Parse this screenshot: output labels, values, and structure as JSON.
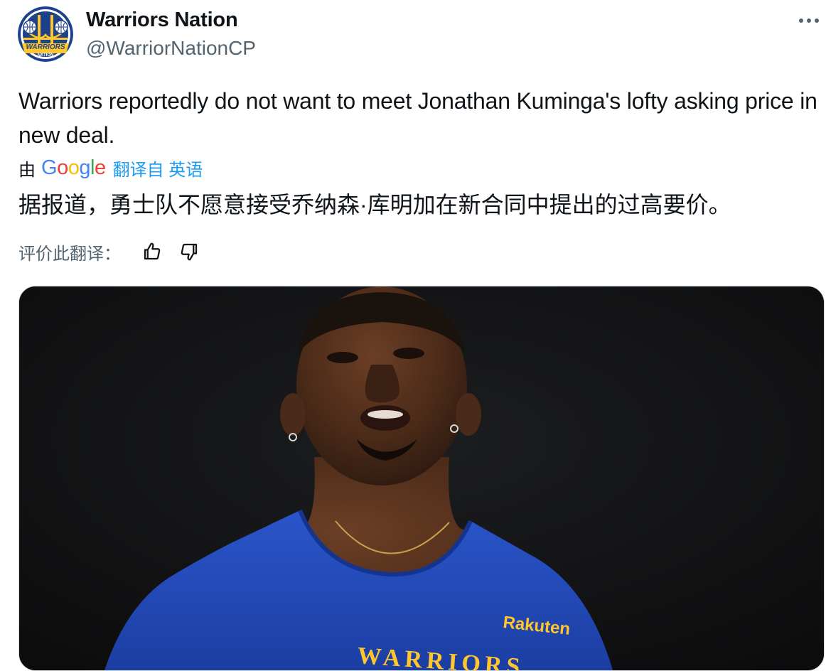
{
  "author": {
    "name": "Warriors Nation",
    "handle": "@WarriorNationCP",
    "avatar_text": "WARRIORS NATION"
  },
  "tweet": {
    "text": "Warriors reportedly do not want to meet Jonathan Kuminga's lofty asking price in new deal."
  },
  "translation": {
    "by_label": "由",
    "provider": [
      "G",
      "o",
      "o",
      "g",
      "l",
      "e"
    ],
    "from_label": "翻译自 英语",
    "text": "据报道，勇士队不愿意接受乔纳森·库明加在新合同中提出的过高要价。"
  },
  "rating": {
    "label": "评价此翻译："
  },
  "media": {
    "jersey_sponsor": "Rakuten",
    "jersey_text": "WARRIORS"
  },
  "icons": {
    "more": "more-icon",
    "thumbs_up": "thumbs-up-icon",
    "thumbs_down": "thumbs-down-icon"
  },
  "colors": {
    "text": "#0f1419",
    "secondary": "#536471",
    "link": "#1d9bf0",
    "border": "#cfd9de",
    "warriors_blue": "#1d428a",
    "warriors_gold": "#ffc72c"
  }
}
